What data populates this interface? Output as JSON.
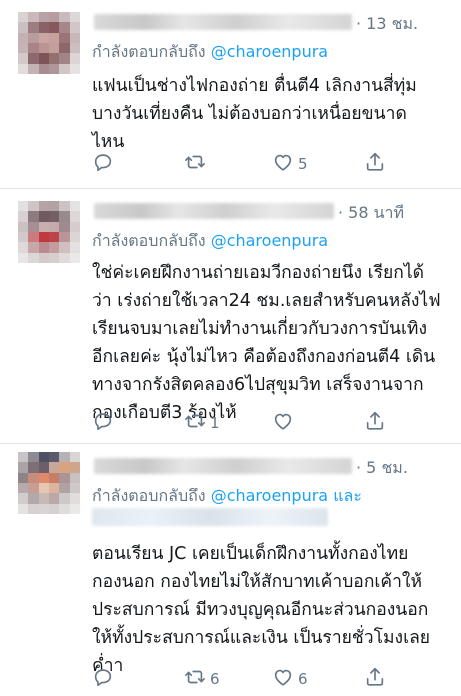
{
  "tweets": [
    {
      "time": "· 13 ชม.",
      "reply_prefix": "กำลังตอบกลับถึง",
      "reply_handle": "@charoenpura",
      "reply_suffix": "",
      "lines": [
        "แฟนเป็นช่างไฟกองถ่าย ตื่นตี4 เลิกงานสี่ทุ่ม",
        "บางวันเที่ยงคืน ไม่ต้องบอกว่าเหนื่อยขนาด",
        "ไหน"
      ],
      "actions": {
        "reply": "",
        "retweet": "",
        "like": "5",
        "share": ""
      }
    },
    {
      "time": "· 58 นาที",
      "reply_prefix": "กำลังตอบกลับถึง",
      "reply_handle": "@charoenpura",
      "reply_suffix": "",
      "lines": [
        "ใช่ค่ะเคยฝึกงานถ่ายเอมวีกองถ่ายนึง เรียกได้",
        "ว่า เร่งถ่ายใช้เวลา24 ชม.เลยสำหรับคนหลังไฟ",
        "เรียนจบมาเลยไม่ทำงานเกี่ยวกับวงการบันเทิง",
        "อีกเลยค่ะ นุ้งไม่ไหว คือต้องถึงกองก่อนตี4 เดิน",
        "ทางจากรังสิตคลอง6ไปสุขุมวิท เสร็จงานจาก",
        "กองเกือบตี3  ร้องไห้"
      ],
      "actions": {
        "reply": "",
        "retweet": "1",
        "like": "",
        "share": ""
      }
    },
    {
      "time": "· 5 ชม.",
      "reply_prefix": "กำลังตอบกลับถึง",
      "reply_handle": "@charoenpura",
      "reply_suffix": "และ",
      "lines": [
        "ตอนเรียน JC เคยเป็นเด็กฝึกงานทั้งกองไทย",
        "กองนอก กองไทยไม่ให้สักบาทเค้าบอกเค้าให้",
        "ประสบการณ์ มีทวงบุญคุณอีกนะส่วนกองนอก",
        "ให้ทั้งประสบการณ์และเงิน เป็นรายชั่วโมงเลย",
        "ค่ำา"
      ],
      "actions": {
        "reply": "",
        "retweet": "6",
        "like": "6",
        "share": ""
      }
    }
  ],
  "icons": {
    "reply": "reply-icon",
    "retweet": "retweet-icon",
    "like": "heart-icon",
    "share": "share-icon"
  },
  "colors": {
    "link": "#1da1f2",
    "secondary": "#657786",
    "text": "#14171a",
    "divider": "#e1e8ed"
  }
}
